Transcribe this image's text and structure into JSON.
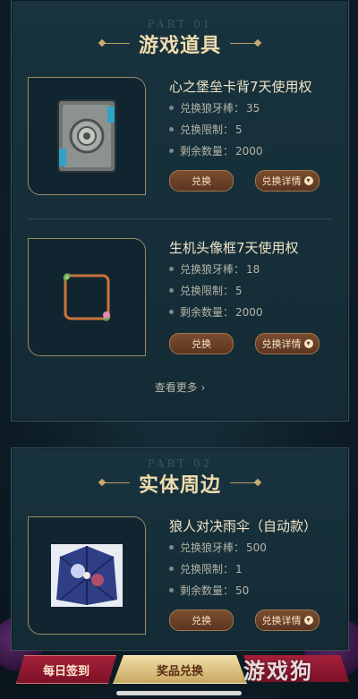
{
  "section1": {
    "part_label": "PART 01",
    "title": "游戏道具",
    "items": [
      {
        "title": "心之堡垒卡背7天使用权",
        "attrs": [
          {
            "label": "兑换狼牙棒：",
            "value": "35"
          },
          {
            "label": "兑换限制：",
            "value": "5"
          },
          {
            "label": "剩余数量：",
            "value": "2000"
          }
        ],
        "redeem_label": "兑换",
        "detail_label": "兑换详情"
      },
      {
        "title": "生机头像框7天使用权",
        "attrs": [
          {
            "label": "兑换狼牙棒：",
            "value": "18"
          },
          {
            "label": "兑换限制：",
            "value": "5"
          },
          {
            "label": "剩余数量：",
            "value": "2000"
          }
        ],
        "redeem_label": "兑换",
        "detail_label": "兑换详情"
      }
    ],
    "view_more": "查看更多 ›"
  },
  "section2": {
    "part_label": "PART 02",
    "title": "实体周边",
    "items": [
      {
        "title": "狼人对决雨伞（自动款）",
        "attrs": [
          {
            "label": "兑换狼牙棒：",
            "value": "500"
          },
          {
            "label": "兑换限制：",
            "value": "1"
          },
          {
            "label": "剩余数量：",
            "value": "50"
          }
        ],
        "redeem_label": "兑换",
        "detail_label": "兑换详情"
      }
    ]
  },
  "nav": {
    "daily": "每日签到",
    "exchange": "奖品兑换",
    "third": ""
  },
  "watermark": "游戏狗",
  "icons": {
    "detail": "chevron-down-icon",
    "more": "chevron-right-icon"
  },
  "colors": {
    "accent_gold": "#f0dcae",
    "button_brown": "#7a4d2e",
    "nav_red": "#a5203a"
  }
}
